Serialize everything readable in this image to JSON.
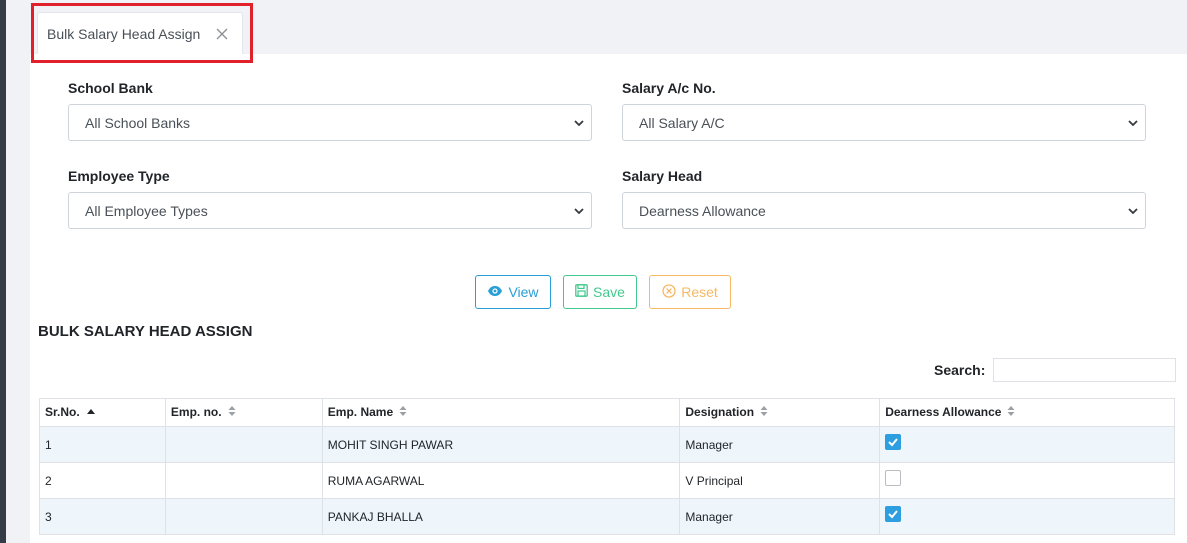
{
  "tab": {
    "title": "Bulk Salary Head Assign"
  },
  "filters": {
    "school_bank": {
      "label": "School Bank",
      "value": "All School Banks"
    },
    "salary_ac": {
      "label": "Salary A/c No.",
      "value": "All Salary A/C"
    },
    "employee_type": {
      "label": "Employee Type",
      "value": "All Employee Types"
    },
    "salary_head": {
      "label": "Salary Head",
      "value": "Dearness Allowance"
    }
  },
  "buttons": {
    "view": "View",
    "save": "Save",
    "reset": "Reset"
  },
  "section_title": "BULK SALARY HEAD ASSIGN",
  "search": {
    "label": "Search:",
    "value": ""
  },
  "table": {
    "headers": [
      "Sr.No.",
      "Emp. no.",
      "Emp. Name",
      "Designation",
      "Dearness Allowance"
    ],
    "rows": [
      {
        "sr": "1",
        "emp_no": "",
        "name": "MOHIT SINGH PAWAR",
        "designation": "Manager",
        "checked": true
      },
      {
        "sr": "2",
        "emp_no": "",
        "name": "RUMA AGARWAL",
        "designation": "V Principal",
        "checked": false
      },
      {
        "sr": "3",
        "emp_no": "",
        "name": "PANKAJ BHALLA",
        "designation": "Manager",
        "checked": true
      }
    ]
  },
  "colors": {
    "accent": "#2a9fd6",
    "save": "#42c98d",
    "reset": "#f7b864",
    "highlight": "#e0202b"
  }
}
